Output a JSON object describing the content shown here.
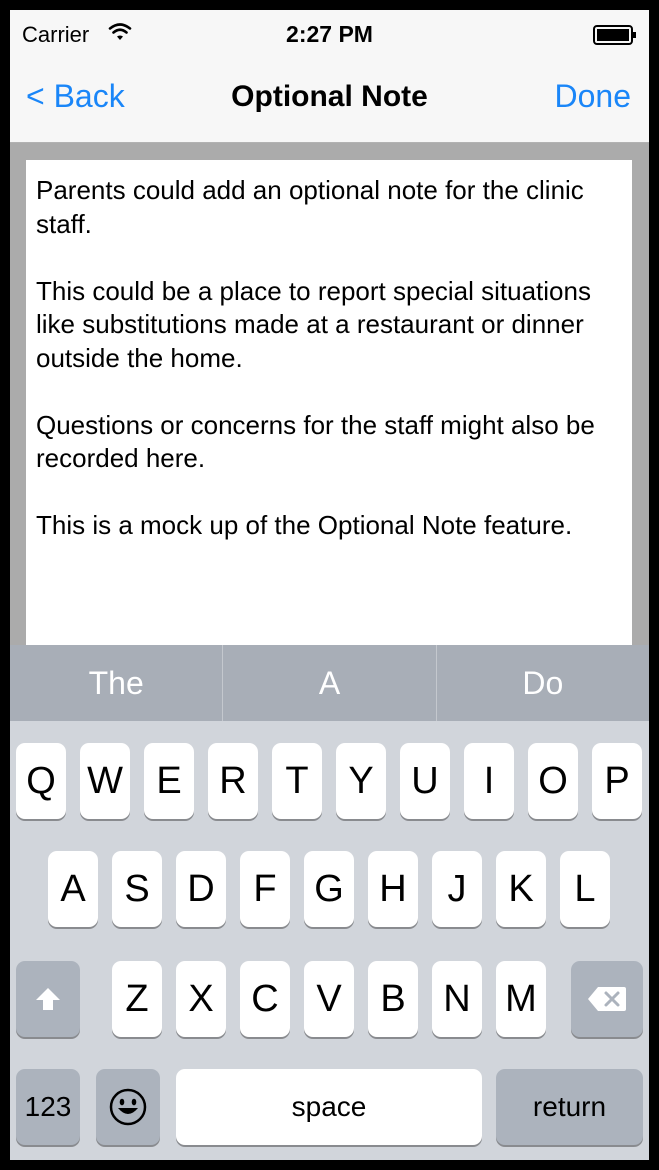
{
  "status": {
    "carrier": "Carrier",
    "time": "2:27 PM"
  },
  "nav": {
    "back_label": "< Back",
    "title": "Optional Note",
    "done_label": "Done"
  },
  "note": {
    "paragraphs": [
      "Parents could add an optional note for the clinic staff.",
      "This could be a place to report special situations like substitutions made at a restaurant or dinner outside the home.",
      "Questions or concerns for the staff might also be recorded here.",
      "This is a mock up of the Optional Note feature."
    ]
  },
  "predictions": [
    "The",
    "A",
    "Do"
  ],
  "keyboard": {
    "row1": [
      "Q",
      "W",
      "E",
      "R",
      "T",
      "Y",
      "U",
      "I",
      "O",
      "P"
    ],
    "row2": [
      "A",
      "S",
      "D",
      "F",
      "G",
      "H",
      "J",
      "K",
      "L"
    ],
    "row3": [
      "Z",
      "X",
      "C",
      "V",
      "B",
      "N",
      "M"
    ],
    "numbers_label": "123",
    "space_label": "space",
    "return_label": "return",
    "shift_icon": "shift-icon",
    "delete_icon": "backspace-icon",
    "emoji_icon": "emoji-icon"
  },
  "colors": {
    "accent": "#1a86f8"
  }
}
